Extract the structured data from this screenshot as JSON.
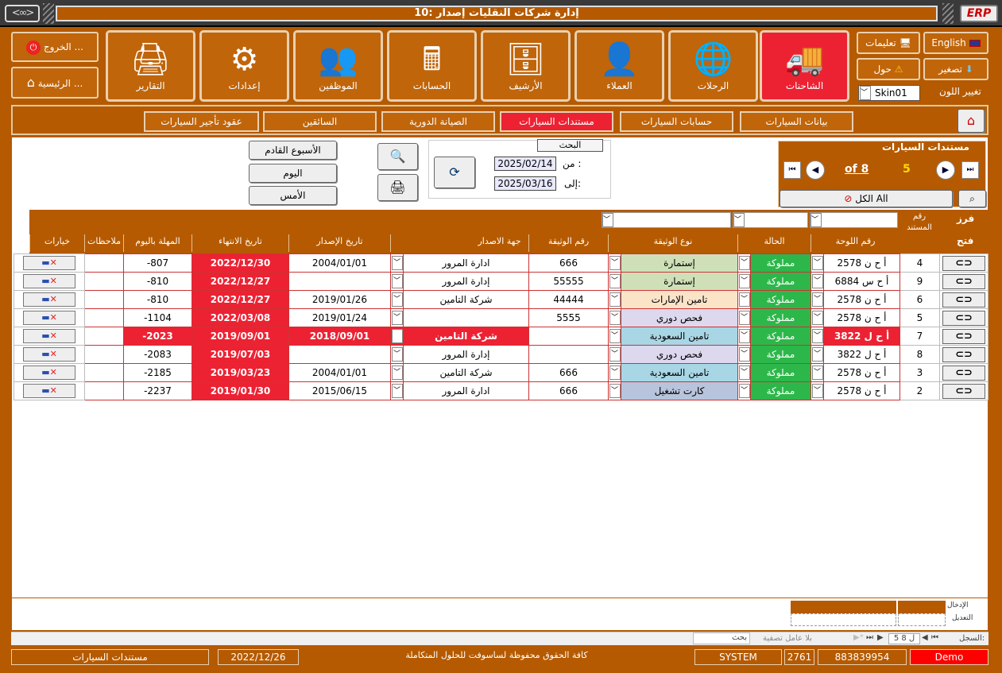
{
  "window": {
    "title": "إدارة شركات النقليات إصدار :10",
    "logo_left": "<∞>",
    "logo_right": "ERP"
  },
  "sidebar_left": {
    "exit": "الخروج ...",
    "home": "الرئيسية ..."
  },
  "modules": [
    {
      "label": "التقارير",
      "icon": "🖨"
    },
    {
      "label": "إعدادات",
      "icon": "⚙"
    },
    {
      "label": "الموظفين",
      "icon": "👥"
    },
    {
      "label": "الحسابات",
      "icon": "🖩"
    },
    {
      "label": "الأرشيف",
      "icon": "🗄"
    },
    {
      "label": "العملاء",
      "icon": "👤"
    },
    {
      "label": "الرحلات",
      "icon": "🌐"
    },
    {
      "label": "الشاحنات",
      "icon": "🚚"
    }
  ],
  "right_panel": {
    "english": "English",
    "instructions": "تعليمات",
    "minimize": "تصغير",
    "about": "حول",
    "color_label": "تغيير اللون",
    "skin": "Skin01"
  },
  "tabs": [
    "عقود تأجير السيارات",
    "السائقين",
    "الصيانة الدورية",
    "مستندات السيارات",
    "حسابات السيارات",
    "بيانات السيارات"
  ],
  "filters": {
    "next_week": "الأسبوع القادم",
    "today": "اليوم",
    "yesterday": "الأمس",
    "search_title": "البحث",
    "from_label": "من :",
    "to_label": "إلى:",
    "from_date": "2025/02/14",
    "to_date": "2025/03/16"
  },
  "records": {
    "title": "مستندات السيارات",
    "of": "of 8",
    "current": "5",
    "all": "الكل All"
  },
  "side_header": {
    "sort": "فرز",
    "open": "فتح",
    "doc_no": "رقم المستند"
  },
  "columns": [
    "خيارات",
    "ملاحظات",
    "المهلة باليوم",
    "تاريخ الانتهاء",
    "تاريخ الإصدار",
    "جهة الاصدار",
    "رقم الوثيقة",
    "نوع الوثيقة",
    "الحالة",
    "رقم اللوحة"
  ],
  "rows": [
    {
      "id": "4",
      "plate": "أ ح ن 2578",
      "status": "مملوكة",
      "type": "إستمارة",
      "type_color": "#cfe0b8",
      "doc": "666",
      "issuer": "ادارة المرور",
      "issue": "2004/01/01",
      "expire": "2022/12/30",
      "days": "-807",
      "sel": false
    },
    {
      "id": "9",
      "plate": "أ ح س 6884",
      "status": "مملوكة",
      "type": "إستمارة",
      "type_color": "#cfe0b8",
      "doc": "55555",
      "issuer": "إدارة المرور",
      "issue": "",
      "expire": "2022/12/27",
      "days": "-810",
      "sel": false
    },
    {
      "id": "6",
      "plate": "أ ح ن 2578",
      "status": "مملوكة",
      "type": "تامين الإمارات",
      "type_color": "#fbe3c8",
      "doc": "44444",
      "issuer": "شركة التامين",
      "issue": "2019/01/26",
      "expire": "2022/12/27",
      "days": "-810",
      "sel": false
    },
    {
      "id": "5",
      "plate": "أ ح ن 2578",
      "status": "مملوكة",
      "type": "فحص دوري",
      "type_color": "#ddd8ee",
      "doc": "5555",
      "issuer": "",
      "issue": "2019/01/24",
      "expire": "2022/03/08",
      "days": "-1104",
      "sel": false
    },
    {
      "id": "7",
      "plate": "أ ح ل 3822",
      "status": "مملوكة",
      "type": "تامين السعودية",
      "type_color": "#a9d6e5",
      "doc": "",
      "issuer": "شركة التامين",
      "issue": "2018/09/01",
      "expire": "2019/09/01",
      "days": "-2023",
      "sel": true
    },
    {
      "id": "8",
      "plate": "أ ح ل 3822",
      "status": "مملوكة",
      "type": "فحص دوري",
      "type_color": "#ddd8ee",
      "doc": "",
      "issuer": "إدارة المرور",
      "issue": "",
      "expire": "2019/07/03",
      "days": "-2083",
      "sel": false
    },
    {
      "id": "3",
      "plate": "أ ح ن 2578",
      "status": "مملوكة",
      "type": "تامين السعودية",
      "type_color": "#a9d6e5",
      "doc": "666",
      "issuer": "شركة التامين",
      "issue": "2004/01/01",
      "expire": "2019/03/23",
      "days": "-2185",
      "sel": false
    },
    {
      "id": "2",
      "plate": "أ ح ن 2578",
      "status": "مملوكة",
      "type": "كارت تشغيل",
      "type_color": "#b8c4dc",
      "doc": "666",
      "issuer": "ادارة المرور",
      "issue": "2015/06/15",
      "expire": "2019/01/30",
      "days": "-2237",
      "sel": false
    }
  ],
  "totals": {
    "entry": "الإدخال",
    "edit": "التعديل"
  },
  "navbar": {
    "record_label": "السجل:",
    "record_pos": "5 ل 8",
    "no_filter": "بلا عامل تصفية",
    "search": "بحث"
  },
  "footer": {
    "form": "مستندات السيارات",
    "date": "2022/12/26",
    "copyright": "كافة الحقوق محفوظة لساسوفت للحلول المتكاملة",
    "user": "SYSTEM",
    "n1": "2761",
    "n2": "883839954",
    "mode": "Demo"
  }
}
